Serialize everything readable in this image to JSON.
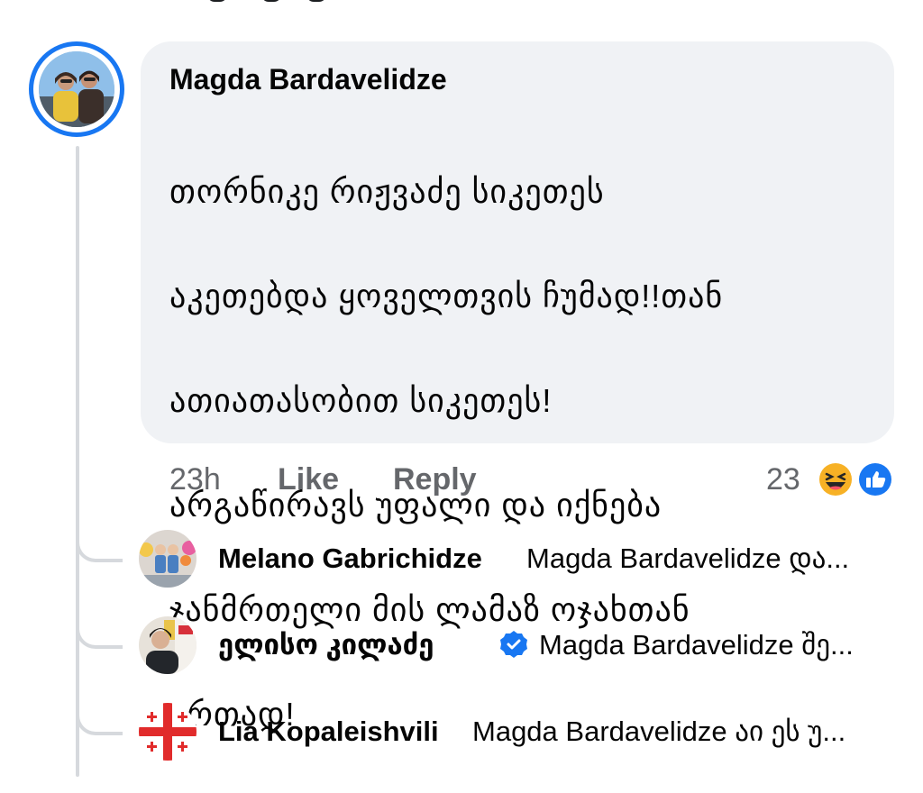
{
  "comment": {
    "author": "Magda Bardavelidze",
    "text_lines": [
      "თორნიკე რიჟვაძე სიკეთეს",
      "აკეთებდა ყოველთვის ჩუმად!!თან",
      "ათიათასობით სიკეთეს!",
      "არგაწირავს უფალი და იქნება",
      "ჯანმრთელი მის ლამაზ ოჯახთან",
      "ერთად!"
    ],
    "time": "23h",
    "like_label": "Like",
    "reply_label": "Reply",
    "reaction_count": "23",
    "reaction_icons": [
      "haha-emoji-icon",
      "like-thumb-icon"
    ]
  },
  "replies": [
    {
      "name": "Melano Gabrichidze",
      "snippet": "Magda Bardavelidze და...",
      "verified": false
    },
    {
      "name": "ელისო კილაძე",
      "snippet": "Magda Bardavelidze შე...",
      "verified": true
    },
    {
      "name": "Lia Kopaleishvili",
      "snippet": "Magda Bardavelidze აი ეს უ...",
      "verified": false
    }
  ],
  "colors": {
    "accent": "#1877f2",
    "bubble": "#f0f2f5",
    "secondary_text": "#65676b",
    "thread_line": "#d6d9dd"
  }
}
